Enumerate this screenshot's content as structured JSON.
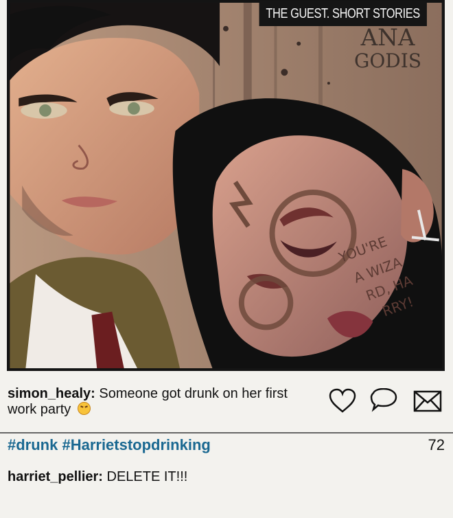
{
  "header": {
    "series_title": "THE GUEST. SHORT STORIES",
    "artist_name": "ANA",
    "artist_surname": "GODIS"
  },
  "art": {
    "face_writing_1": "YOU'RE",
    "face_writing_2": "A WIZA",
    "face_writing_3": "RD, HA",
    "face_writing_4": "RRY!"
  },
  "post": {
    "username": "simon_healy:",
    "caption": "Someone got drunk on her first work party",
    "emoji": "laughing-squint-emoji",
    "hashtags": "#drunk #Harrietstopdrinking",
    "likes": "72"
  },
  "comment": {
    "username": "harriet_pellier:",
    "text": "DELETE IT!!!"
  },
  "actions": {
    "like_icon": "heart-icon",
    "comment_icon": "speech-bubble-icon",
    "share_icon": "envelope-icon"
  },
  "colors": {
    "hashtag": "#1a6891",
    "frame": "#141414",
    "background": "#f3f2ee"
  }
}
